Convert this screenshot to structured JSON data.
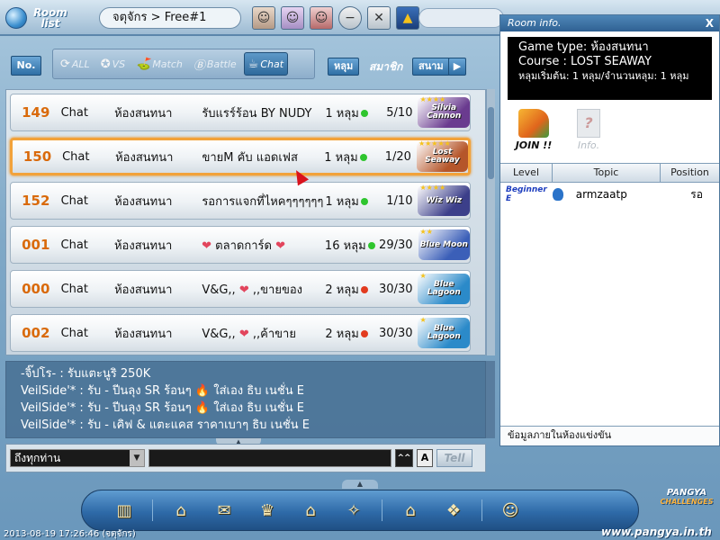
{
  "topbar": {
    "logo_label": "Room list",
    "location": "จตุจักร > Free#1",
    "icons": [
      "avatar-icon",
      "avatar-icon",
      "avatar-icon",
      "minus-icon",
      "close-icon",
      "chart-icon"
    ]
  },
  "filters": {
    "no_label": "No.",
    "tabs": [
      {
        "label": "ALL",
        "icon": "⟳",
        "active": false
      },
      {
        "label": "VS",
        "icon": "✪",
        "active": false
      },
      {
        "label": "Match",
        "icon": "⛳",
        "active": false
      },
      {
        "label": "Battle",
        "icon": "Ⓑ",
        "active": false
      },
      {
        "label": "Chat",
        "icon": "☕",
        "active": true
      }
    ],
    "hole_label": "หลุม",
    "member_label": "สมาชิก",
    "course_label": "สนาม",
    "next_label": "▶"
  },
  "rooms": [
    {
      "no": "149",
      "type": "Chat",
      "mode": "ห้องสนทนา",
      "name": "รับแรร์ร้อน BY NUDY",
      "holes": "1 หลุม",
      "status": "green",
      "players": "5/10",
      "course": "Silvia Cannon",
      "course_color": "#6a3b8f",
      "stars": "★★★★"
    },
    {
      "no": "150",
      "type": "Chat",
      "mode": "ห้องสนทนา",
      "name": "ขายM คับ แอดเฟส",
      "holes": "1 หลุม",
      "status": "green",
      "players": "1/20",
      "course": "Lost Seaway",
      "course_color": "#b5562a",
      "stars": "★★★★★",
      "selected": true
    },
    {
      "no": "152",
      "type": "Chat",
      "mode": "ห้องสนทนา",
      "name": "รอการแจกที่ไหคๆๆๆๆๆๆ",
      "holes": "1 หลุม",
      "status": "green",
      "players": "1/10",
      "course": "Wiz Wiz",
      "course_color": "#3c3f8a",
      "stars": "★★★★"
    },
    {
      "no": "001",
      "type": "Chat",
      "mode": "ห้องสนทนา",
      "name_pre": "",
      "name": "ตลาดการ์ด",
      "hearts": true,
      "holes": "16 หลุม",
      "status": "green",
      "players": "29/30",
      "course": "Blue Moon",
      "course_color": "#3b5fb8",
      "stars": "★★"
    },
    {
      "no": "000",
      "type": "Chat",
      "mode": "ห้องสนทนา",
      "name_pre": "V&G,,",
      "name": ",,ขายของ",
      "hearts": true,
      "holes": "2 หลุม",
      "status": "red",
      "players": "30/30",
      "course": "Blue Lagoon",
      "course_color": "#2b8ac9",
      "stars": "★"
    },
    {
      "no": "002",
      "type": "Chat",
      "mode": "ห้องสนทนา",
      "name_pre": "V&G,,",
      "name": ",,ค้าขาย",
      "hearts": true,
      "holes": "2 หลุม",
      "status": "red",
      "players": "30/30",
      "course": "Blue Lagoon",
      "course_color": "#2b8ac9",
      "stars": "★"
    }
  ],
  "chat": {
    "lines": [
      "-จิ๊ปโร- : รับแตะนูริ 250K",
      "VeilSide'* : รับ - ปีนลุง SR ร้อนๆ 🔥 ใส่เอง ธิบ เนชั่น E",
      "VeilSide'* : รับ - ปีนลุง SR ร้อนๆ 🔥 ใส่เอง ธิบ เนชั่น E",
      "VeilSide'* : รับ - เคิฟ & แตะแคส ราคาเบาๆ ธิบ เนชั่น E"
    ],
    "target": "ถึงทุกท่าน",
    "tag_a": "A",
    "tag_caret": "^^",
    "tell_label": "Tell"
  },
  "room_info": {
    "title": "Room info.",
    "close": "X",
    "game_type": "Game type: ห้องสนทนา",
    "course": "Course : LOST SEAWAY",
    "holes": "หลุมเริ่มต้น: 1 หลุม/จำนวนหลุม: 1 หลุม",
    "join_label": "JOIN !!",
    "info_label": "Info.",
    "headers": {
      "level": "Level",
      "topic": "Topic",
      "position": "Position"
    },
    "players": [
      {
        "level": "Beginner E",
        "name": "armzaatp",
        "position": "รอ"
      }
    ],
    "footer": "ข้อมูลภายในห้องแข่งขัน"
  },
  "dock": {
    "icons": [
      "door-icon",
      "shop-icon",
      "gift-icon",
      "trophy-icon",
      "house-icon",
      "puzzle-icon",
      "home-icon",
      "cards-icon",
      "exit-icon"
    ]
  },
  "status": {
    "timestamp": "2013-08-19 17:26:46 (จตุจักร)",
    "brand": "PANGYA",
    "brand_sub": "CHALLENGES",
    "url": "www.pangya.in.th"
  },
  "colors": {
    "accent": "#2f6fa5",
    "room_number": "#d96a0b",
    "selected_border": "#f2a23a",
    "status_green": "#2ec52e",
    "status_red": "#e23b1f"
  }
}
